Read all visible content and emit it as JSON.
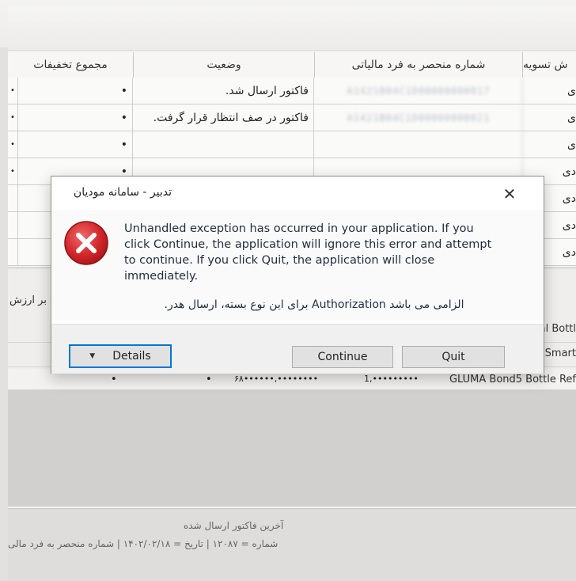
{
  "table": {
    "headers": {
      "discounts": "مجموع تخفیفات",
      "status": "وضعیت",
      "tax_id": "شماره منحصر به فرد مالیاتی",
      "settlement": "ش تسویه"
    },
    "rows": [
      {
        "status": "فاکتور ارسال شد.",
        "discount_dot": "•",
        "tax_id": "A1421B04C1D00000000017",
        "settle": "ی"
      },
      {
        "status": "فاکتور در صف انتظار قرار گرفت.",
        "discount_dot": "•",
        "tax_id": "A1421B04C1D00000000021",
        "settle": "ی"
      },
      {
        "status": "",
        "discount_dot": "•",
        "tax_id": "",
        "settle": "ی"
      },
      {
        "status": "",
        "discount_dot": "•",
        "tax_id": "",
        "settle": "دی"
      },
      {
        "status": "",
        "discount_dot": "",
        "tax_id": "",
        "settle": "دی"
      },
      {
        "status": "",
        "discount_dot": "",
        "tax_id": "",
        "settle": "دی"
      },
      {
        "status": "",
        "discount_dot": "",
        "tax_id": "",
        "settle": "دی"
      }
    ]
  },
  "lower": {
    "label": "ت بر ارزش",
    "products": [
      "versal Bottl",
      "sma Smart"
    ],
    "last_row": {
      "name": "GLUMA Bond5 Bottle Ref",
      "amount1": "1,•••••••••",
      "amount2": "۶۸••••••,••••••••",
      "dot1": "•",
      "dot2": "•"
    }
  },
  "footer": {
    "line1": "آخرین فاکتور ارسال شده",
    "line2": "شماره = ۱۲۰۸۷ | تاریخ = ۱۴۰۲/۰۲/۱۸ | شماره منحصر به فرد مالی"
  },
  "dialog": {
    "title": "تدبیر - سامانه مودیان",
    "close_glyph": "✕",
    "message": "Unhandled exception has occurred in your application. If you click Continue, the application will ignore this error and attempt to continue. If you click Quit, the application will close immediately.",
    "detail": "الزامی می باشد Authorization برای این نوع بسته، ارسال هدر.",
    "buttons": {
      "details": "Details",
      "continue": "Continue",
      "quit": "Quit"
    },
    "icon": "error-icon",
    "colors": {
      "error_red": "#d4282d",
      "focus_blue": "#0078d7"
    }
  }
}
